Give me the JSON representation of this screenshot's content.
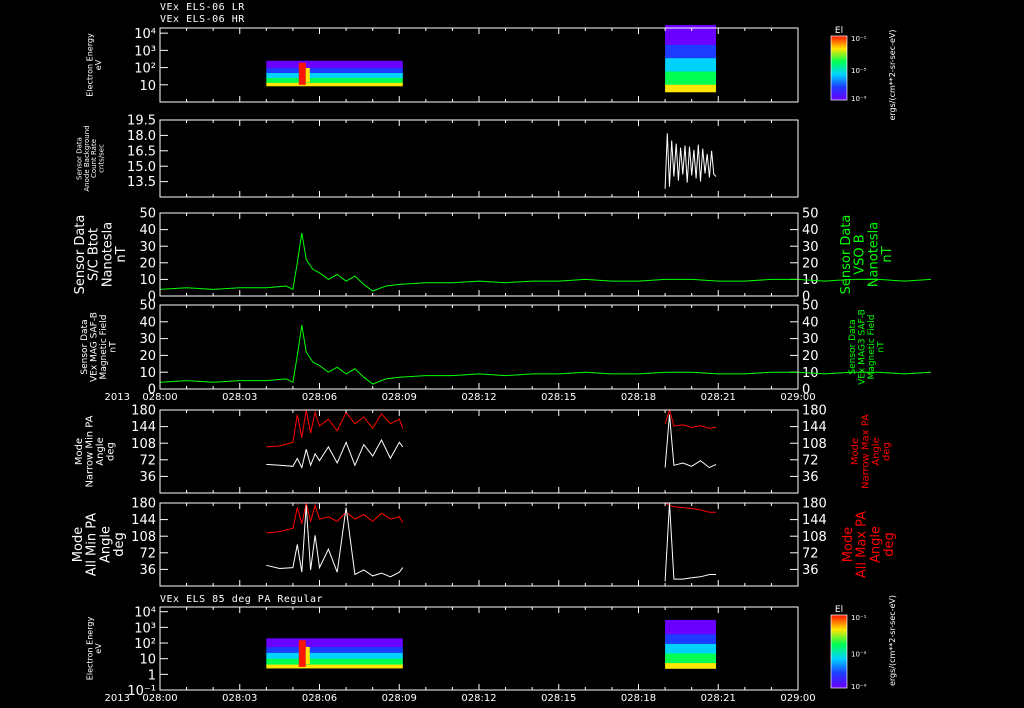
{
  "header": {
    "line1": "VEx ELS-06 LR",
    "line2": "VEx ELS-06 HR",
    "bottom_title": "VEx ELS 85 deg PA Regular"
  },
  "colors": {
    "background": "#000000",
    "frame": "#ffffff",
    "green": "#00ff00",
    "red": "#ff0000",
    "white": "#ffffff"
  },
  "chart_data": [
    {
      "id": "p1",
      "type": "heatmap",
      "ylabel": [
        "Electron Energy",
        "eV"
      ],
      "y_ticks": [
        "10",
        "10²",
        "10³",
        "10⁴"
      ],
      "y_log": true,
      "colorbar": {
        "title": "El",
        "ticks": [
          "10⁻¹",
          "10⁻⁵",
          "10⁻⁹"
        ],
        "unit": "ergs/(cm**2-sr-sec-eV)"
      },
      "blocks": [
        {
          "x_start": "028:04:00",
          "x_end": "028:09:08",
          "energy_range": [
            10,
            250
          ]
        },
        {
          "x_start": "028:19:00",
          "x_end": "028:20:55",
          "energy_range": [
            5,
            30000
          ]
        }
      ]
    },
    {
      "id": "p2",
      "type": "line",
      "ylabel": [
        "Sensor Data",
        "Anode Background",
        "Count Rate",
        "cnts/sec"
      ],
      "y_ticks": [
        "13.5",
        "15.0",
        "16.5",
        "18.0",
        "19.5"
      ],
      "ylim": [
        12.0,
        19.5
      ],
      "series": [
        {
          "color": "white",
          "x": [
            "028:19:00",
            "028:19:05",
            "028:19:10",
            "028:19:15",
            "028:19:20",
            "028:19:25",
            "028:19:30",
            "028:19:35",
            "028:19:40",
            "028:19:45",
            "028:19:50",
            "028:19:55",
            "028:20:00",
            "028:20:05",
            "028:20:10",
            "028:20:15",
            "028:20:20",
            "028:20:25",
            "028:20:30",
            "028:20:35",
            "028:20:40",
            "028:20:45",
            "028:20:50",
            "028:20:55"
          ],
          "values": [
            12.8,
            18.2,
            13.0,
            17.5,
            14.0,
            17.2,
            13.6,
            16.8,
            14.2,
            17.0,
            13.4,
            16.9,
            14.1,
            16.6,
            13.8,
            17.1,
            13.5,
            16.7,
            14.3,
            16.2,
            13.9,
            16.5,
            14.2,
            14.0
          ]
        }
      ]
    },
    {
      "id": "p3",
      "type": "line",
      "ylabel": [
        "Sensor Data",
        "S/C Btot",
        "Nanotesla",
        "nT"
      ],
      "ylabel_right": [
        "Sensor Data",
        "VSO B",
        "Nanotesla",
        "nT"
      ],
      "y_ticks": [
        "0",
        "10",
        "20",
        "30",
        "40",
        "50"
      ],
      "ylim": [
        0,
        50
      ],
      "series": [
        {
          "color": "green",
          "x": [
            "028:00:00",
            "028:01:00",
            "028:02:00",
            "028:03:00",
            "028:04:00",
            "028:04:45",
            "028:05:00",
            "028:05:10",
            "028:05:20",
            "028:05:30",
            "028:05:45",
            "028:06:00",
            "028:06:20",
            "028:06:40",
            "028:07:00",
            "028:07:20",
            "028:07:40",
            "028:08:00",
            "028:08:30",
            "028:09:00",
            "028:10:00",
            "028:11:00",
            "028:12:00",
            "028:13:00",
            "028:14:00",
            "028:15:00",
            "028:16:00",
            "028:17:00",
            "028:18:00",
            "028:19:00",
            "028:20:00",
            "028:21:00",
            "028:22:00",
            "028:23:00",
            "028:24:00",
            "028:25:00",
            "028:26:00",
            "028:27:00",
            "028:28:00",
            "028:29:00"
          ],
          "values": [
            4,
            5,
            4,
            5,
            5,
            6,
            4,
            20,
            38,
            22,
            16,
            14,
            10,
            13,
            9,
            12,
            7,
            3,
            6,
            7,
            8,
            8,
            9,
            8,
            9,
            9,
            10,
            9,
            9,
            10,
            10,
            9,
            9,
            10,
            10,
            9,
            10,
            10,
            9,
            10
          ]
        }
      ]
    },
    {
      "id": "p4",
      "type": "line",
      "ylabel": [
        "Sensor Data",
        "VEx MAG SAF-B",
        "Magnetic Field",
        "nT"
      ],
      "ylabel_right": [
        "Sensor Data",
        "VEx MAG3 SAF-B",
        "Magnetic Field",
        "nT"
      ],
      "y_ticks": [
        "0",
        "10",
        "20",
        "30",
        "40",
        "50"
      ],
      "ylim": [
        0,
        50
      ],
      "series": [
        {
          "color": "green",
          "x": [
            "028:00:00",
            "028:01:00",
            "028:02:00",
            "028:03:00",
            "028:04:00",
            "028:04:45",
            "028:05:00",
            "028:05:10",
            "028:05:20",
            "028:05:30",
            "028:05:45",
            "028:06:00",
            "028:06:20",
            "028:06:40",
            "028:07:00",
            "028:07:20",
            "028:07:40",
            "028:08:00",
            "028:08:30",
            "028:09:00",
            "028:10:00",
            "028:11:00",
            "028:12:00",
            "028:13:00",
            "028:14:00",
            "028:15:00",
            "028:16:00",
            "028:17:00",
            "028:18:00",
            "028:19:00",
            "028:20:00",
            "028:21:00",
            "028:22:00",
            "028:23:00",
            "028:24:00",
            "028:25:00",
            "028:26:00",
            "028:27:00",
            "028:28:00",
            "028:29:00"
          ],
          "values": [
            4,
            5,
            4,
            5,
            5,
            6,
            4,
            20,
            38,
            22,
            16,
            14,
            10,
            13,
            9,
            12,
            7,
            3,
            6,
            7,
            8,
            8,
            9,
            8,
            9,
            9,
            10,
            9,
            9,
            10,
            10,
            9,
            9,
            10,
            10,
            9,
            10,
            10,
            9,
            10
          ]
        }
      ]
    },
    {
      "id": "p5",
      "type": "line",
      "ylabel": [
        "Mode",
        "Narrow Min PA",
        "Angle",
        "deg"
      ],
      "ylabel_right": [
        "Mode",
        "Narrow Max PA",
        "Angle",
        "deg"
      ],
      "y_ticks": [
        "36",
        "72",
        "108",
        "144",
        "180"
      ],
      "ylim": [
        0,
        180
      ],
      "series": [
        {
          "color": "red",
          "x": [
            "028:04:00",
            "028:04:30",
            "028:05:00",
            "028:05:10",
            "028:05:20",
            "028:05:30",
            "028:05:40",
            "028:05:50",
            "028:06:00",
            "028:06:20",
            "028:06:40",
            "028:07:00",
            "028:07:20",
            "028:07:40",
            "028:08:00",
            "028:08:20",
            "028:08:40",
            "028:09:00",
            "028:09:08"
          ],
          "values": [
            100,
            102,
            110,
            170,
            120,
            180,
            130,
            175,
            145,
            160,
            135,
            175,
            150,
            165,
            140,
            172,
            150,
            160,
            140
          ]
        },
        {
          "color": "white",
          "x": [
            "028:04:00",
            "028:04:30",
            "028:05:00",
            "028:05:10",
            "028:05:20",
            "028:05:30",
            "028:05:40",
            "028:05:50",
            "028:06:00",
            "028:06:20",
            "028:06:40",
            "028:07:00",
            "028:07:20",
            "028:07:40",
            "028:08:00",
            "028:08:20",
            "028:08:40",
            "028:09:00",
            "028:09:08"
          ],
          "values": [
            62,
            60,
            58,
            75,
            55,
            95,
            60,
            85,
            70,
            100,
            65,
            110,
            60,
            105,
            80,
            115,
            75,
            110,
            100
          ]
        },
        {
          "color": "red",
          "x": [
            "028:19:00",
            "028:19:10",
            "028:19:20",
            "028:19:40",
            "028:20:00",
            "028:20:20",
            "028:20:40",
            "028:20:55"
          ],
          "values": [
            150,
            180,
            145,
            148,
            142,
            146,
            140,
            143
          ]
        },
        {
          "color": "white",
          "x": [
            "028:19:00",
            "028:19:10",
            "028:19:20",
            "028:19:40",
            "028:20:00",
            "028:20:20",
            "028:20:40",
            "028:20:55"
          ],
          "values": [
            55,
            170,
            60,
            65,
            58,
            70,
            55,
            62
          ]
        }
      ]
    },
    {
      "id": "p6",
      "type": "line",
      "ylabel": [
        "Mode",
        "All Min PA",
        "Angle",
        "deg"
      ],
      "ylabel_right": [
        "Mode",
        "All Max PA",
        "Angle",
        "deg"
      ],
      "y_ticks": [
        "36",
        "72",
        "108",
        "144",
        "180"
      ],
      "ylim": [
        0,
        180
      ],
      "series": [
        {
          "color": "red",
          "x": [
            "028:04:00",
            "028:04:30",
            "028:05:00",
            "028:05:10",
            "028:05:20",
            "028:05:30",
            "028:05:40",
            "028:05:50",
            "028:06:00",
            "028:06:20",
            "028:06:40",
            "028:07:00",
            "028:07:20",
            "028:07:40",
            "028:08:00",
            "028:08:20",
            "028:08:40",
            "028:09:00",
            "028:09:08"
          ],
          "values": [
            115,
            118,
            125,
            170,
            135,
            180,
            140,
            175,
            145,
            150,
            140,
            160,
            145,
            155,
            140,
            158,
            145,
            150,
            138
          ]
        },
        {
          "color": "white",
          "x": [
            "028:04:00",
            "028:04:30",
            "028:05:00",
            "028:05:10",
            "028:05:20",
            "028:05:30",
            "028:05:40",
            "028:05:50",
            "028:06:00",
            "028:06:20",
            "028:06:40",
            "028:07:00",
            "028:07:20",
            "028:07:40",
            "028:08:00",
            "028:08:20",
            "028:08:40",
            "028:09:00",
            "028:09:08"
          ],
          "values": [
            45,
            38,
            40,
            90,
            30,
            175,
            35,
            110,
            40,
            80,
            30,
            170,
            25,
            35,
            22,
            28,
            20,
            30,
            40
          ]
        },
        {
          "color": "red",
          "x": [
            "028:19:00",
            "028:19:10",
            "028:19:20",
            "028:19:40",
            "028:20:00",
            "028:20:20",
            "028:20:40",
            "028:20:55"
          ],
          "values": [
            180,
            175,
            172,
            170,
            168,
            165,
            160,
            160
          ]
        },
        {
          "color": "white",
          "x": [
            "028:19:00",
            "028:19:10",
            "028:19:20",
            "028:19:40",
            "028:20:00",
            "028:20:20",
            "028:20:40",
            "028:20:55"
          ],
          "values": [
            10,
            180,
            15,
            15,
            18,
            20,
            25,
            25
          ]
        }
      ]
    },
    {
      "id": "p7",
      "type": "heatmap",
      "ylabel": [
        "Electron Energy",
        "eV"
      ],
      "y_ticks": [
        "10⁻¹",
        "1",
        "10",
        "10²",
        "10³",
        "10⁴"
      ],
      "y_log": true,
      "colorbar": {
        "title": "El",
        "ticks": [
          "10⁻¹",
          "10⁻⁵",
          "10⁻⁹"
        ],
        "unit": "ergs/(cm**2-sr-sec-eV)"
      },
      "blocks": [
        {
          "x_start": "028:04:00",
          "x_end": "028:09:08",
          "energy_range": [
            3,
            200
          ]
        },
        {
          "x_start": "028:19:00",
          "x_end": "028:20:55",
          "energy_range": [
            3,
            3000
          ]
        }
      ]
    }
  ],
  "time_axis": {
    "year_label": "2013",
    "ticks": [
      "028:00",
      "028:03",
      "028:06",
      "028:09",
      "028:12",
      "028:15",
      "028:18",
      "028:21",
      "029:00"
    ],
    "start": "028:00:00",
    "end": "029:00"
  }
}
